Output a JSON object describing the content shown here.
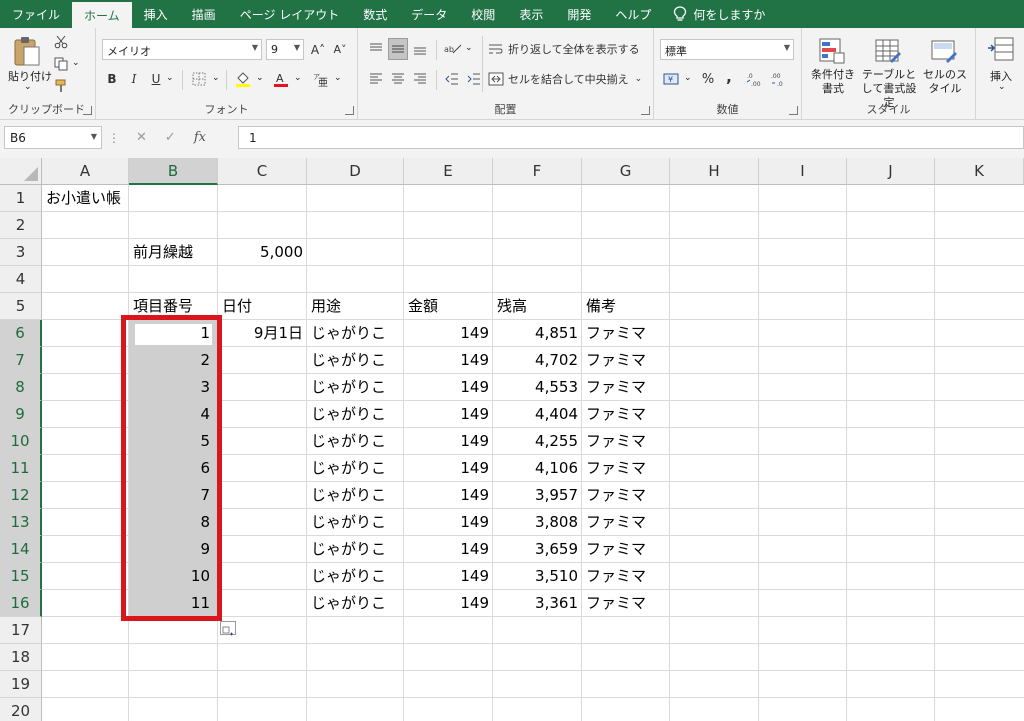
{
  "menu": {
    "tabs": [
      "ファイル",
      "ホーム",
      "挿入",
      "描画",
      "ページ レイアウト",
      "数式",
      "データ",
      "校閲",
      "表示",
      "開発",
      "ヘルプ"
    ],
    "active_tab": "ホーム",
    "tell_me": "何をしますか"
  },
  "ribbon": {
    "clipboard": {
      "paste": "貼り付け",
      "label": "クリップボード"
    },
    "font": {
      "name": "メイリオ",
      "size": "9",
      "bold": "B",
      "italic": "I",
      "underline": "U",
      "label": "フォント"
    },
    "alignment": {
      "wrap_text": "折り返して全体を表示する",
      "merge_center": "セルを結合して中央揃え",
      "label": "配置"
    },
    "number": {
      "format": "標準",
      "percent": "%",
      "comma": ",",
      "label": "数値"
    },
    "styles": {
      "conditional": "条件付き書式",
      "table": "テーブルとして書式設定",
      "cell_styles": "セルのスタイル",
      "label": "スタイル"
    },
    "cells": {
      "insert": "挿入"
    }
  },
  "formula_bar": {
    "name_box": "B6",
    "cancel": "✕",
    "enter": "✓",
    "fx": "fx",
    "formula": "1"
  },
  "grid": {
    "columns": [
      "A",
      "B",
      "C",
      "D",
      "E",
      "F",
      "G",
      "H",
      "I",
      "J",
      "K"
    ],
    "selected_column": "B",
    "rows": [
      "1",
      "2",
      "3",
      "4",
      "5",
      "6",
      "7",
      "8",
      "9",
      "10",
      "11",
      "12",
      "13",
      "14",
      "15",
      "16",
      "17",
      "18",
      "19",
      "20"
    ],
    "selected_rows": [
      "6",
      "7",
      "8",
      "9",
      "10",
      "11",
      "12",
      "13",
      "14",
      "15",
      "16"
    ],
    "title": "お小遣い帳",
    "carry_label": "前月繰越",
    "carry_value": "5,000",
    "headers": {
      "item_no": "項目番号",
      "date": "日付",
      "use": "用途",
      "amount": "金額",
      "balance": "残高",
      "note": "備考"
    },
    "first_date": "9月1日",
    "entries": [
      {
        "no": "1",
        "use": "じゃがりこ",
        "amount": "149",
        "balance": "4,851",
        "note": "ファミマ"
      },
      {
        "no": "2",
        "use": "じゃがりこ",
        "amount": "149",
        "balance": "4,702",
        "note": "ファミマ"
      },
      {
        "no": "3",
        "use": "じゃがりこ",
        "amount": "149",
        "balance": "4,553",
        "note": "ファミマ"
      },
      {
        "no": "4",
        "use": "じゃがりこ",
        "amount": "149",
        "balance": "4,404",
        "note": "ファミマ"
      },
      {
        "no": "5",
        "use": "じゃがりこ",
        "amount": "149",
        "balance": "4,255",
        "note": "ファミマ"
      },
      {
        "no": "6",
        "use": "じゃがりこ",
        "amount": "149",
        "balance": "4,106",
        "note": "ファミマ"
      },
      {
        "no": "7",
        "use": "じゃがりこ",
        "amount": "149",
        "balance": "3,957",
        "note": "ファミマ"
      },
      {
        "no": "8",
        "use": "じゃがりこ",
        "amount": "149",
        "balance": "3,808",
        "note": "ファミマ"
      },
      {
        "no": "9",
        "use": "じゃがりこ",
        "amount": "149",
        "balance": "3,659",
        "note": "ファミマ"
      },
      {
        "no": "10",
        "use": "じゃがりこ",
        "amount": "149",
        "balance": "3,510",
        "note": "ファミマ"
      },
      {
        "no": "11",
        "use": "じゃがりこ",
        "amount": "149",
        "balance": "3,361",
        "note": "ファミマ"
      }
    ]
  },
  "colors": {
    "excel_green": "#217346",
    "highlight_red": "#d9161c",
    "selection_gray": "#cfcfcf"
  }
}
